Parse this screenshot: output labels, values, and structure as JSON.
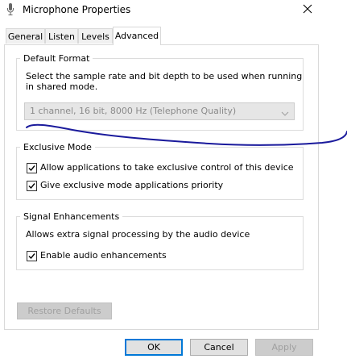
{
  "window": {
    "title": "Microphone Properties",
    "icons": {
      "app": "microphone-icon",
      "close": "close-icon"
    }
  },
  "tabs": [
    {
      "label": "General",
      "active": false
    },
    {
      "label": "Listen",
      "active": false
    },
    {
      "label": "Levels",
      "active": false
    },
    {
      "label": "Advanced",
      "active": true
    }
  ],
  "default_format": {
    "title": "Default Format",
    "description_line1": "Select the sample rate and bit depth to be used when running",
    "description_line2": "in shared mode.",
    "selected_format": "1 channel, 16 bit, 8000 Hz (Telephone Quality)",
    "enabled": false
  },
  "exclusive_mode": {
    "title": "Exclusive Mode",
    "options": [
      {
        "label": "Allow applications to take exclusive control of this device",
        "checked": true
      },
      {
        "label": "Give exclusive mode applications priority",
        "checked": true
      }
    ]
  },
  "signal_enhancements": {
    "title": "Signal Enhancements",
    "description": "Allows extra signal processing by the audio device",
    "option": {
      "label": "Enable audio enhancements",
      "checked": true
    }
  },
  "buttons": {
    "restore_defaults": "Restore Defaults",
    "ok": "OK",
    "cancel": "Cancel",
    "apply": "Apply"
  },
  "colors": {
    "accent": "#0078d7",
    "annotation_stroke": "#1a1a9c"
  }
}
